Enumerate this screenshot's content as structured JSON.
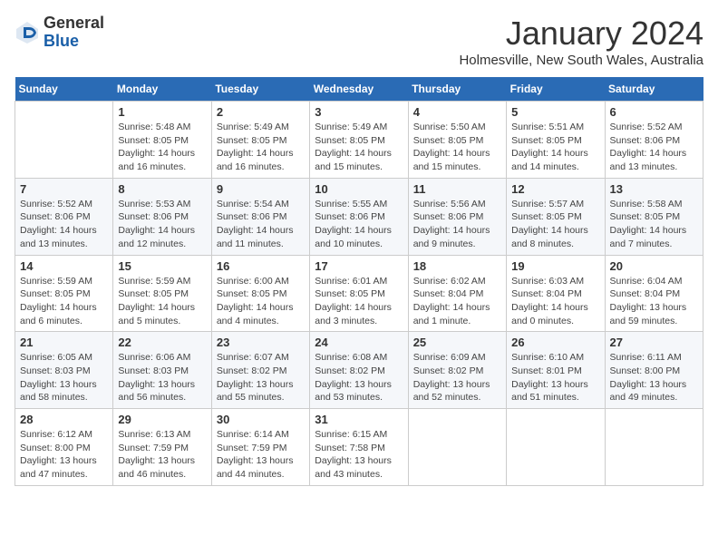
{
  "header": {
    "logo_line1": "General",
    "logo_line2": "Blue",
    "month": "January 2024",
    "location": "Holmesville, New South Wales, Australia"
  },
  "days_of_week": [
    "Sunday",
    "Monday",
    "Tuesday",
    "Wednesday",
    "Thursday",
    "Friday",
    "Saturday"
  ],
  "weeks": [
    [
      {
        "day": "",
        "info": ""
      },
      {
        "day": "1",
        "info": "Sunrise: 5:48 AM\nSunset: 8:05 PM\nDaylight: 14 hours\nand 16 minutes."
      },
      {
        "day": "2",
        "info": "Sunrise: 5:49 AM\nSunset: 8:05 PM\nDaylight: 14 hours\nand 16 minutes."
      },
      {
        "day": "3",
        "info": "Sunrise: 5:49 AM\nSunset: 8:05 PM\nDaylight: 14 hours\nand 15 minutes."
      },
      {
        "day": "4",
        "info": "Sunrise: 5:50 AM\nSunset: 8:05 PM\nDaylight: 14 hours\nand 15 minutes."
      },
      {
        "day": "5",
        "info": "Sunrise: 5:51 AM\nSunset: 8:05 PM\nDaylight: 14 hours\nand 14 minutes."
      },
      {
        "day": "6",
        "info": "Sunrise: 5:52 AM\nSunset: 8:06 PM\nDaylight: 14 hours\nand 13 minutes."
      }
    ],
    [
      {
        "day": "7",
        "info": "Sunrise: 5:52 AM\nSunset: 8:06 PM\nDaylight: 14 hours\nand 13 minutes."
      },
      {
        "day": "8",
        "info": "Sunrise: 5:53 AM\nSunset: 8:06 PM\nDaylight: 14 hours\nand 12 minutes."
      },
      {
        "day": "9",
        "info": "Sunrise: 5:54 AM\nSunset: 8:06 PM\nDaylight: 14 hours\nand 11 minutes."
      },
      {
        "day": "10",
        "info": "Sunrise: 5:55 AM\nSunset: 8:06 PM\nDaylight: 14 hours\nand 10 minutes."
      },
      {
        "day": "11",
        "info": "Sunrise: 5:56 AM\nSunset: 8:06 PM\nDaylight: 14 hours\nand 9 minutes."
      },
      {
        "day": "12",
        "info": "Sunrise: 5:57 AM\nSunset: 8:05 PM\nDaylight: 14 hours\nand 8 minutes."
      },
      {
        "day": "13",
        "info": "Sunrise: 5:58 AM\nSunset: 8:05 PM\nDaylight: 14 hours\nand 7 minutes."
      }
    ],
    [
      {
        "day": "14",
        "info": "Sunrise: 5:59 AM\nSunset: 8:05 PM\nDaylight: 14 hours\nand 6 minutes."
      },
      {
        "day": "15",
        "info": "Sunrise: 5:59 AM\nSunset: 8:05 PM\nDaylight: 14 hours\nand 5 minutes."
      },
      {
        "day": "16",
        "info": "Sunrise: 6:00 AM\nSunset: 8:05 PM\nDaylight: 14 hours\nand 4 minutes."
      },
      {
        "day": "17",
        "info": "Sunrise: 6:01 AM\nSunset: 8:05 PM\nDaylight: 14 hours\nand 3 minutes."
      },
      {
        "day": "18",
        "info": "Sunrise: 6:02 AM\nSunset: 8:04 PM\nDaylight: 14 hours\nand 1 minute."
      },
      {
        "day": "19",
        "info": "Sunrise: 6:03 AM\nSunset: 8:04 PM\nDaylight: 14 hours\nand 0 minutes."
      },
      {
        "day": "20",
        "info": "Sunrise: 6:04 AM\nSunset: 8:04 PM\nDaylight: 13 hours\nand 59 minutes."
      }
    ],
    [
      {
        "day": "21",
        "info": "Sunrise: 6:05 AM\nSunset: 8:03 PM\nDaylight: 13 hours\nand 58 minutes."
      },
      {
        "day": "22",
        "info": "Sunrise: 6:06 AM\nSunset: 8:03 PM\nDaylight: 13 hours\nand 56 minutes."
      },
      {
        "day": "23",
        "info": "Sunrise: 6:07 AM\nSunset: 8:02 PM\nDaylight: 13 hours\nand 55 minutes."
      },
      {
        "day": "24",
        "info": "Sunrise: 6:08 AM\nSunset: 8:02 PM\nDaylight: 13 hours\nand 53 minutes."
      },
      {
        "day": "25",
        "info": "Sunrise: 6:09 AM\nSunset: 8:02 PM\nDaylight: 13 hours\nand 52 minutes."
      },
      {
        "day": "26",
        "info": "Sunrise: 6:10 AM\nSunset: 8:01 PM\nDaylight: 13 hours\nand 51 minutes."
      },
      {
        "day": "27",
        "info": "Sunrise: 6:11 AM\nSunset: 8:00 PM\nDaylight: 13 hours\nand 49 minutes."
      }
    ],
    [
      {
        "day": "28",
        "info": "Sunrise: 6:12 AM\nSunset: 8:00 PM\nDaylight: 13 hours\nand 47 minutes."
      },
      {
        "day": "29",
        "info": "Sunrise: 6:13 AM\nSunset: 7:59 PM\nDaylight: 13 hours\nand 46 minutes."
      },
      {
        "day": "30",
        "info": "Sunrise: 6:14 AM\nSunset: 7:59 PM\nDaylight: 13 hours\nand 44 minutes."
      },
      {
        "day": "31",
        "info": "Sunrise: 6:15 AM\nSunset: 7:58 PM\nDaylight: 13 hours\nand 43 minutes."
      },
      {
        "day": "",
        "info": ""
      },
      {
        "day": "",
        "info": ""
      },
      {
        "day": "",
        "info": ""
      }
    ]
  ]
}
